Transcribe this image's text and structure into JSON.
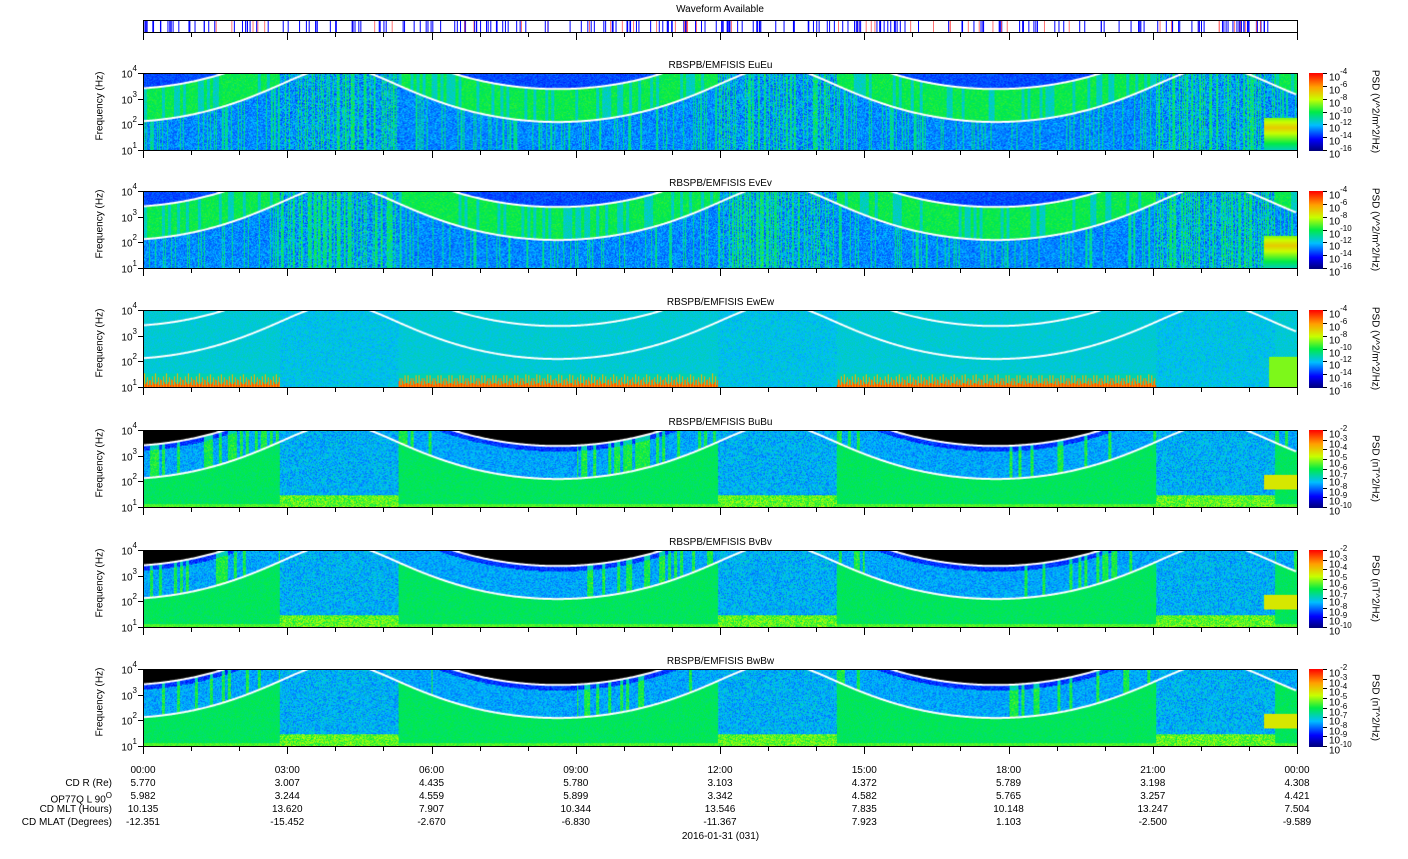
{
  "waveform": {
    "title": "Waveform Available",
    "colors": {
      "burst1": "#0000ff",
      "burst2": "#ff5050"
    }
  },
  "y_axis_label": "Frequency (Hz)",
  "y_ticks": [
    {
      "base": "10",
      "exp": "4"
    },
    {
      "base": "10",
      "exp": "3"
    },
    {
      "base": "10",
      "exp": "2"
    },
    {
      "base": "10",
      "exp": "1"
    }
  ],
  "panels": [
    {
      "title": "RBSPB/EMFISIS  EuEu",
      "kind": "E",
      "colorbar_label": "PSD (V^2/m^2/Hz)",
      "colorbar_ticks": [
        "-4",
        "-6",
        "-8",
        "-10",
        "-12",
        "-14",
        "-16"
      ]
    },
    {
      "title": "RBSPB/EMFISIS  EvEv",
      "kind": "E",
      "colorbar_label": "PSD (V^2/m^2/Hz)",
      "colorbar_ticks": [
        "-4",
        "-6",
        "-8",
        "-10",
        "-12",
        "-14",
        "-16"
      ]
    },
    {
      "title": "RBSPB/EMFISIS  EwEw",
      "kind": "Ew",
      "colorbar_label": "PSD (V^2/m^2/Hz)",
      "colorbar_ticks": [
        "-4",
        "-6",
        "-8",
        "-10",
        "-12",
        "-14",
        "-16"
      ]
    },
    {
      "title": "RBSPB/EMFISIS  BuBu",
      "kind": "B",
      "colorbar_label": "PSD (nT^2/Hz)",
      "colorbar_ticks": [
        "-2",
        "-3",
        "-4",
        "-5",
        "-6",
        "-7",
        "-8",
        "-9",
        "-10"
      ]
    },
    {
      "title": "RBSPB/EMFISIS  BvBv",
      "kind": "B",
      "colorbar_label": "PSD (nT^2/Hz)",
      "colorbar_ticks": [
        "-2",
        "-3",
        "-4",
        "-5",
        "-6",
        "-7",
        "-8",
        "-9",
        "-10"
      ]
    },
    {
      "title": "RBSPB/EMFISIS  BwBw",
      "kind": "B",
      "colorbar_label": "PSD (nT^2/Hz)",
      "colorbar_ticks": [
        "-2",
        "-3",
        "-4",
        "-5",
        "-6",
        "-7",
        "-8",
        "-9",
        "-10"
      ]
    }
  ],
  "chart_data": {
    "type": "heatmap",
    "x_ticks": [
      "00:00",
      "03:00",
      "06:00",
      "09:00",
      "12:00",
      "15:00",
      "18:00",
      "21:00",
      "00:00"
    ],
    "x_range_hours": [
      0,
      24
    ],
    "y_range_hz": [
      10,
      10000
    ],
    "y_scale": "log",
    "date_label": "2016-01-31 (031)",
    "ephemeris": [
      {
        "label": "CD R (Re)",
        "sup": "",
        "values": [
          "5.770",
          "3.007",
          "4.435",
          "5.780",
          "3.103",
          "4.372",
          "5.789",
          "3.198",
          "4.308"
        ]
      },
      {
        "label": "OP77Q L 90",
        "sup": "O",
        "values": [
          "5.982",
          "3.244",
          "4.559",
          "5.899",
          "3.342",
          "4.582",
          "5.765",
          "3.257",
          "4.421"
        ]
      },
      {
        "label": "CD MLT (Hours)",
        "sup": "",
        "values": [
          "10.135",
          "13.620",
          "7.907",
          "10.344",
          "13.546",
          "7.835",
          "10.148",
          "13.247",
          "7.504"
        ]
      },
      {
        "label": "CD MLAT (Degrees)",
        "sup": "",
        "values": [
          "-12.351",
          "-15.452",
          "-2.670",
          "-6.830",
          "-11.367",
          "7.923",
          "1.103",
          "-2.500",
          "-9.589"
        ]
      }
    ]
  }
}
